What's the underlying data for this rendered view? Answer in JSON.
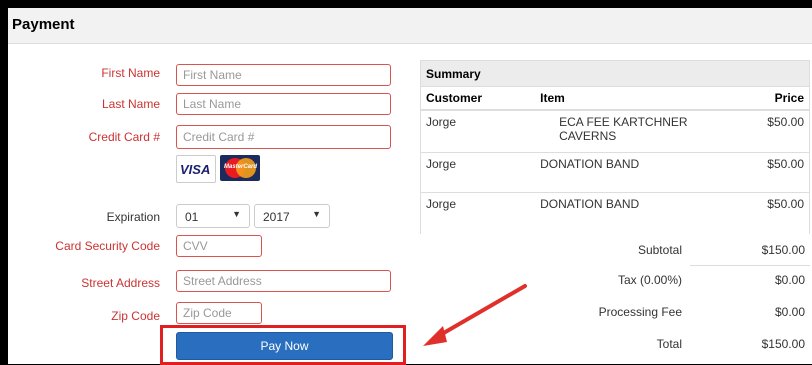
{
  "header": {
    "title": "Payment"
  },
  "form": {
    "first_name": {
      "label": "First Name",
      "placeholder": "First Name"
    },
    "last_name": {
      "label": "Last Name",
      "placeholder": "Last Name"
    },
    "credit_card": {
      "label": "Credit Card #",
      "placeholder": "Credit Card #"
    },
    "cards": {
      "visa": "VISA",
      "mastercard": "MasterCard"
    },
    "expiration": {
      "label": "Expiration",
      "month": "01",
      "year": "2017"
    },
    "cvv": {
      "label": "Card Security Code",
      "placeholder": "CVV"
    },
    "street": {
      "label": "Street Address",
      "placeholder": "Street Address"
    },
    "zip": {
      "label": "Zip Code",
      "placeholder": "Zip Code"
    },
    "pay_button": "Pay Now"
  },
  "summary": {
    "title": "Summary",
    "columns": [
      "Customer",
      "Item",
      "Price"
    ],
    "rows": [
      {
        "customer": "Jorge",
        "item": "ECA FEE KARTCHNER CAVERNS",
        "price": "$50.00"
      },
      {
        "customer": "Jorge",
        "item": "DONATION BAND",
        "price": "$50.00"
      },
      {
        "customer": "Jorge",
        "item": "DONATION BAND",
        "price": "$50.00"
      }
    ],
    "subtotal": {
      "label": "Subtotal",
      "value": "$150.00"
    },
    "tax": {
      "label": "Tax (0.00%)",
      "value": "$0.00"
    },
    "fee": {
      "label": "Processing Fee",
      "value": "$0.00"
    },
    "total": {
      "label": "Total",
      "value": "$150.00"
    }
  },
  "colors": {
    "required_label": "#cc3333",
    "button": "#2a6fbf",
    "highlight": "#e02020"
  }
}
